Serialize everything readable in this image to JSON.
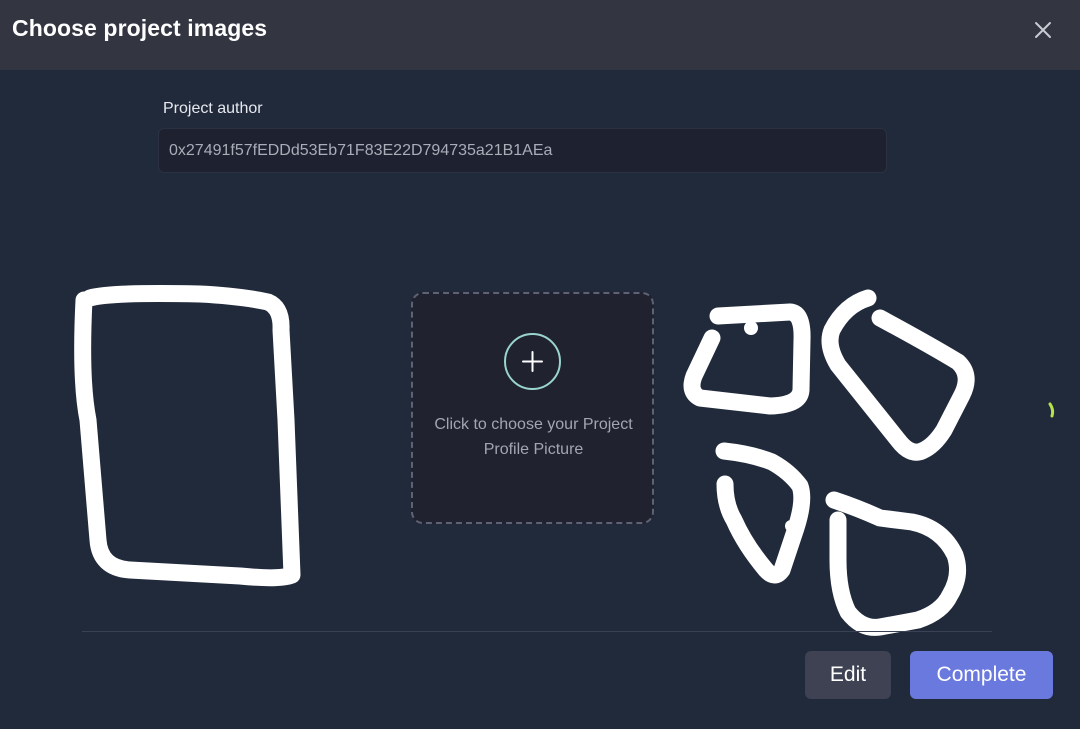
{
  "modal": {
    "title": "Choose project images"
  },
  "author": {
    "label": "Project author",
    "value": "0x27491f57fEDDd53Eb71F83E22D794735a21B1AEa"
  },
  "upload": {
    "prompt": "Click to choose your Project Profile Picture"
  },
  "footer": {
    "edit_label": "Edit",
    "complete_label": "Complete"
  },
  "colors": {
    "background": "#212a3b",
    "header": "#333541",
    "accent": "#6a79de",
    "plus_ring": "#9ad4cf",
    "scribble": "#ffffff"
  },
  "icons": [
    "close-icon",
    "plus-icon"
  ]
}
